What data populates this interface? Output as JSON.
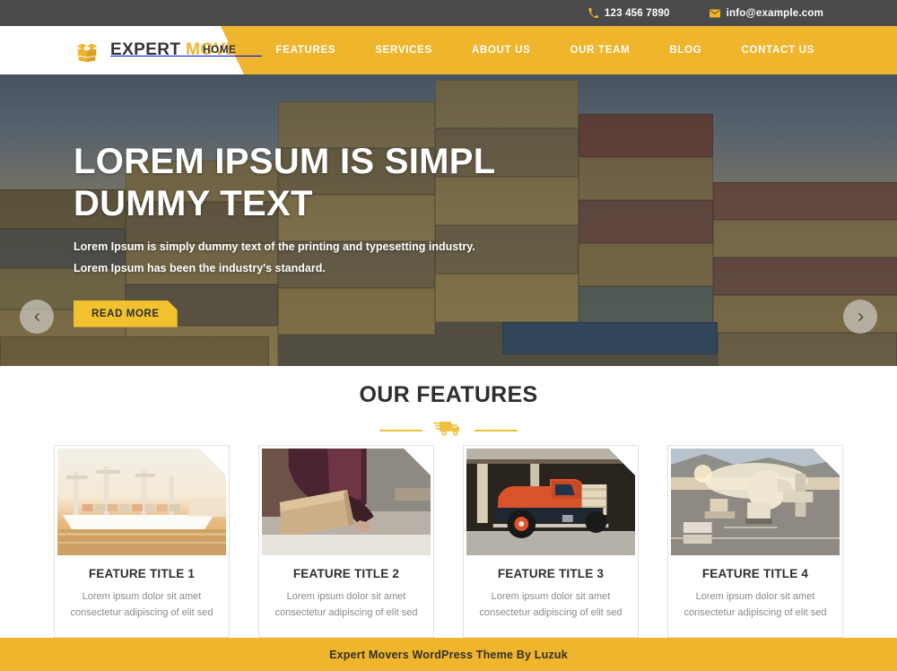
{
  "topbar": {
    "phone_icon": "phone-icon",
    "phone": "123 456 7890",
    "email_icon": "envelope-icon",
    "email": "info@example.com"
  },
  "header": {
    "logo_icon": "open-box-icon",
    "logo_primary": "EXPERT",
    "logo_secondary": "MOVERS",
    "nav": [
      {
        "label": "HOME",
        "active": true
      },
      {
        "label": "FEATURES",
        "active": false
      },
      {
        "label": "SERVICES",
        "active": false
      },
      {
        "label": "ABOUT US",
        "active": false
      },
      {
        "label": "OUR TEAM",
        "active": false
      },
      {
        "label": "BLOG",
        "active": false
      },
      {
        "label": "CONTACT US",
        "active": false
      }
    ]
  },
  "hero": {
    "title_line1": "LOREM IPSUM IS SIMPL",
    "title_line2": "DUMMY TEXT",
    "sub_line1": "Lorem Ipsum is simply dummy text of the printing and typesetting industry.",
    "sub_line2": "Lorem Ipsum has been the industry's standard.",
    "cta_label": "READ MORE",
    "prev_icon": "chevron-left-icon",
    "next_icon": "chevron-right-icon"
  },
  "features": {
    "title": "OUR FEATURES",
    "divider_icon": "delivery-truck-icon",
    "cards": [
      {
        "image_alt": "cargo-ship-at-port",
        "title": "FEATURE TITLE 1",
        "desc_line1": "Lorem ipsum dolor sit amet",
        "desc_line2": "consectetur adipiscing of elit sed"
      },
      {
        "image_alt": "person-packing-cardboard-box",
        "title": "FEATURE TITLE 2",
        "desc_line1": "Lorem ipsum dolor sit amet",
        "desc_line2": "consectetur adipiscing of elit sed"
      },
      {
        "image_alt": "vintage-orange-truck",
        "title": "FEATURE TITLE 3",
        "desc_line1": "Lorem ipsum dolor sit amet",
        "desc_line2": "consectetur adipiscing of elit sed"
      },
      {
        "image_alt": "airport-cargo-loading",
        "title": "FEATURE TITLE 4",
        "desc_line1": "Lorem ipsum dolor sit amet",
        "desc_line2": "consectetur adipiscing of elit sed"
      }
    ]
  },
  "footer": {
    "text": "Expert Movers WordPress Theme By Luzuk"
  },
  "colors": {
    "brand_yellow": "#eeb52d",
    "accent_yellow": "#f2c12e",
    "topbar_gray": "#4a4a4d",
    "heading_dark": "#2e2e30",
    "body_gray": "#8a8a8a"
  }
}
